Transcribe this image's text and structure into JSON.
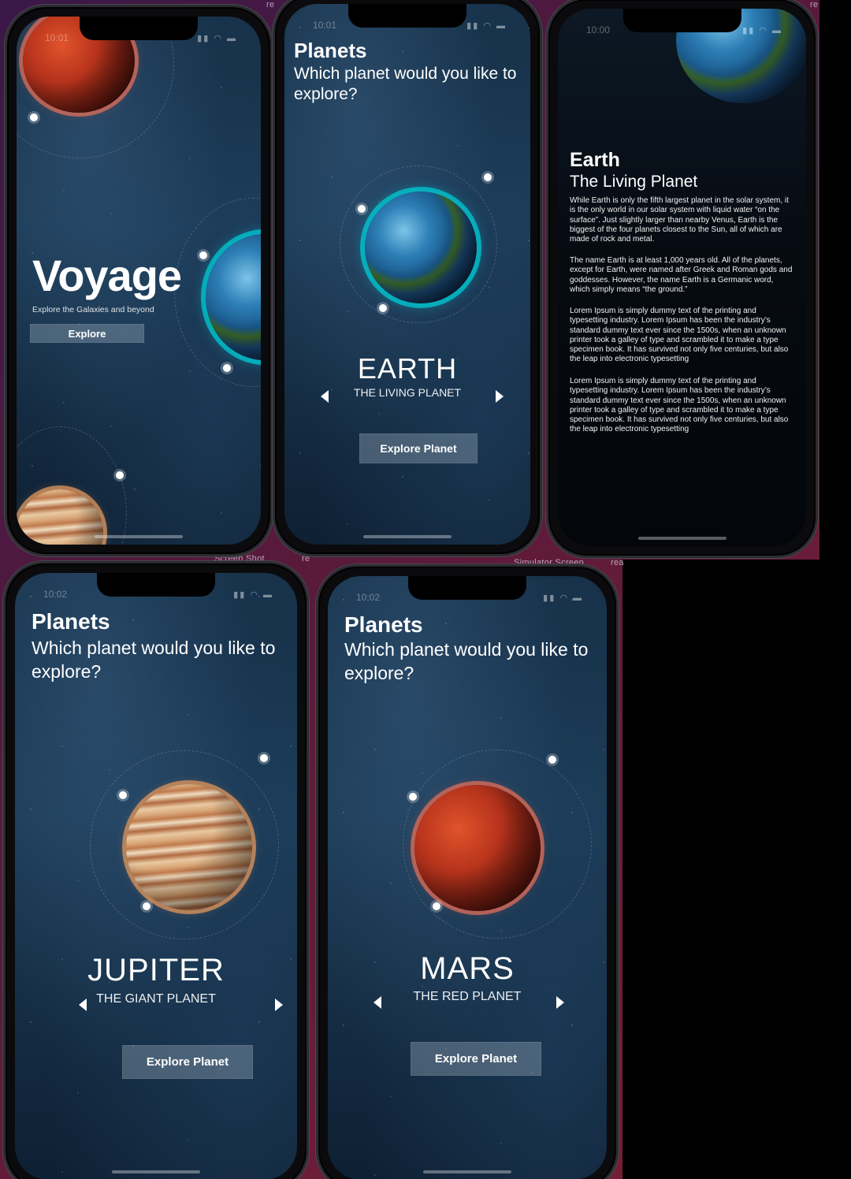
{
  "backdrop_labels": {
    "label_1": "re",
    "label_2": "re",
    "label_3": "Screen Shot",
    "label_4": "re",
    "label_5": "Simulator Screen",
    "label_6": "rea"
  },
  "screen_voyage": {
    "time": "10:01",
    "title": "Voyage",
    "subtitle": "Explore the Galaxies and beyond",
    "button_label": "Explore"
  },
  "screen_earth": {
    "time": "10:01",
    "title": "Planets",
    "question": "Which planet would you like to explore?",
    "planet_name": "EARTH",
    "planet_tagline": "THE LIVING PLANET",
    "button_label": "Explore Planet"
  },
  "screen_detail": {
    "time": "10:00",
    "title": "Earth",
    "subtitle": "The Living Planet",
    "paragraphs": [
      "While Earth is only the fifth largest planet in the solar system, it is the only world in our solar system with liquid water  “on the surface”.  Just slightly larger than nearby Venus, Earth is the biggest of the four planets closest to the Sun, all of which are made of rock and metal.",
      "The name Earth is at least 1,000 years old.  All of the planets, except for Earth, were named after Greek and Roman gods and goddesses. However, the name Earth is a Germanic word, which simply means “the ground.”",
      "Lorem Ipsum is simply dummy text of the printing and typesetting industry. Lorem Ipsum has been the industry’s standard dummy text ever since the 1500s, when an unknown printer took a galley of type and scrambled it to make a type specimen book. It has survived not only five centuries, but also the leap into electronic typesetting",
      "Lorem Ipsum is simply dummy text of the printing and typesetting industry. Lorem Ipsum has been the industry’s standard dummy text ever since the 1500s, when an unknown printer took a galley of type and scrambled it to make a type specimen book. It has survived not only five centuries, but also the leap into electronic typesetting"
    ]
  },
  "screen_jupiter": {
    "time": "10:02",
    "title": "Planets",
    "question": "Which planet would you like to explore?",
    "planet_name": "JUPITER",
    "planet_tagline": "THE GIANT PLANET",
    "button_label": "Explore Planet"
  },
  "screen_mars": {
    "time": "10:02",
    "title": "Planets",
    "question": "Which planet would you like to explore?",
    "planet_name": "MARS",
    "planet_tagline": "THE RED PLANET",
    "button_label": "Explore Planet"
  },
  "status_icons": "▮▮ ◠ ▬",
  "accent_colors": {
    "earth_ring": "#00c8d2",
    "mars_ring": "#dc6e5a",
    "jupiter_ring": "#cd8c5a"
  }
}
